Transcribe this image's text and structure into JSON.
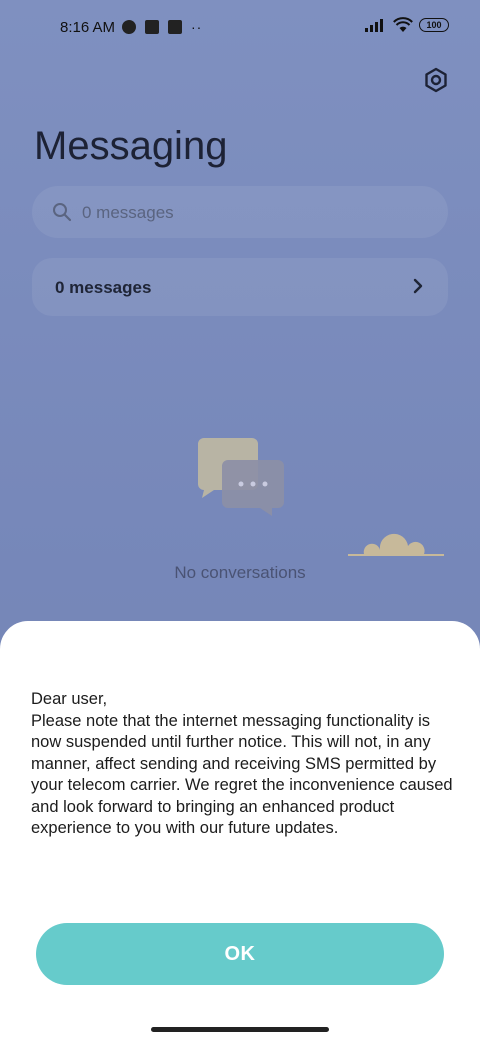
{
  "status_bar": {
    "time": "8:16 AM",
    "battery": "100"
  },
  "header": {
    "title": "Messaging",
    "settings_icon": "gear-icon"
  },
  "search": {
    "placeholder": "0 messages",
    "icon": "search-icon"
  },
  "messages_row": {
    "label": "0 messages",
    "icon": "chevron-right-icon"
  },
  "empty_state": {
    "text": "No conversations",
    "illustration": "chat-bubbles-icon"
  },
  "dialog": {
    "message": "Dear user,\nPlease note that the internet messaging functionality is now suspended until further notice. This will not, in any manner, affect sending and receiving SMS permitted by your telecom carrier. We regret the inconvenience caused and look forward to bringing an enhanced product experience to you with our future updates.",
    "ok_label": "OK",
    "ok_color": "#66cbcb"
  }
}
